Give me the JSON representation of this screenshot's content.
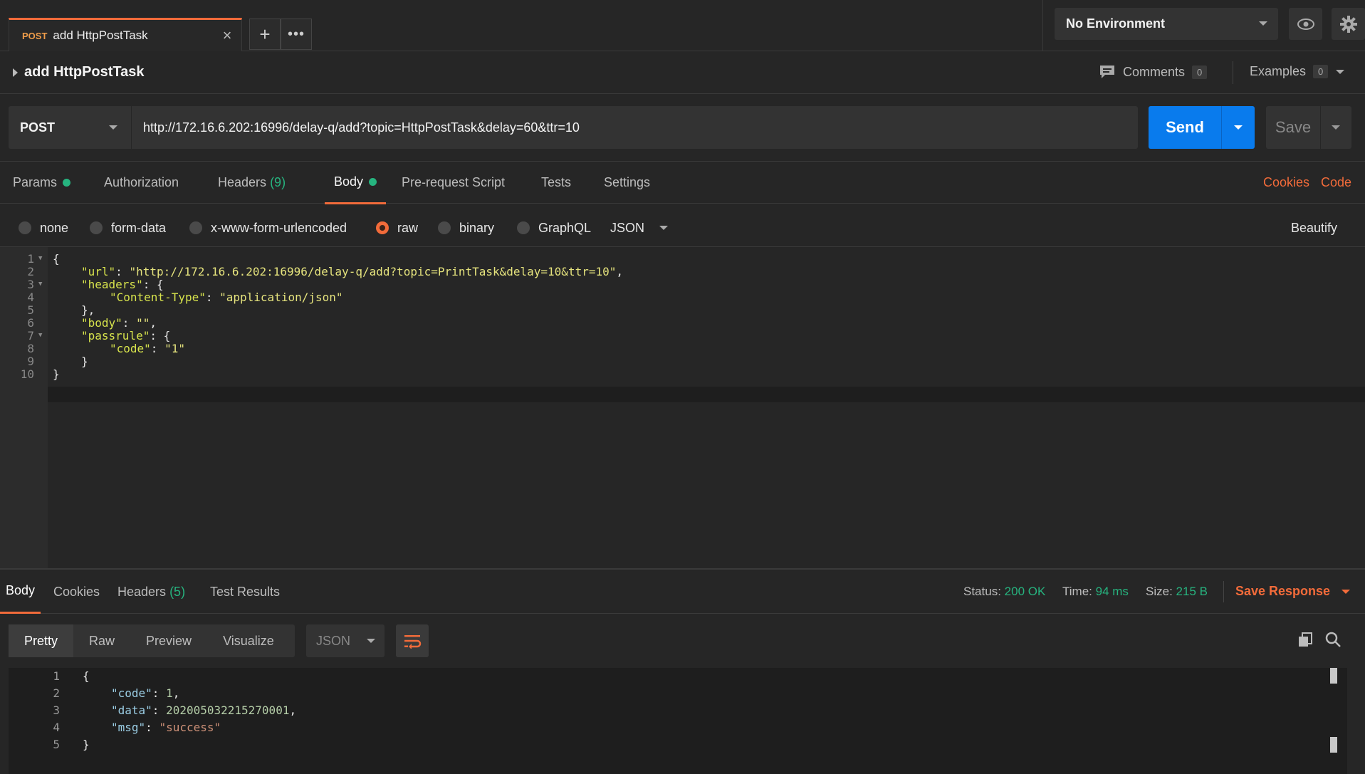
{
  "tab": {
    "method": "POST",
    "name": "add HttpPostTask"
  },
  "environment": {
    "selected": "No Environment"
  },
  "request": {
    "title": "add HttpPostTask",
    "comments_label": "Comments",
    "comments_count": "0",
    "examples_label": "Examples",
    "examples_count": "0",
    "method": "POST",
    "url": "http://172.16.6.202:16996/delay-q/add?topic=HttpPostTask&delay=60&ttr=10",
    "send_label": "Send",
    "save_label": "Save"
  },
  "request_tabs": {
    "params": "Params",
    "authorization": "Authorization",
    "headers": "Headers",
    "headers_count": "(9)",
    "body": "Body",
    "prerequest": "Pre-request Script",
    "tests": "Tests",
    "settings": "Settings",
    "cookies": "Cookies",
    "code": "Code"
  },
  "body_modes": {
    "none": "none",
    "form_data": "form-data",
    "urlencoded": "x-www-form-urlencoded",
    "raw": "raw",
    "binary": "binary",
    "graphql": "GraphQL",
    "format": "JSON",
    "beautify": "Beautify",
    "selected": "raw"
  },
  "request_body_lines": [
    {
      "n": "1",
      "t": "{"
    },
    {
      "n": "2",
      "k": "\"url\"",
      "v": "\"http://172.16.6.202:16996/delay-q/add?topic=PrintTask&delay=10&ttr=10\"",
      "e": ","
    },
    {
      "n": "3",
      "k": "\"headers\"",
      "e": ": {"
    },
    {
      "n": "4",
      "k": "\"Content-Type\"",
      "v": "\"application/json\""
    },
    {
      "n": "5",
      "t": "},"
    },
    {
      "n": "6",
      "k": "\"body\"",
      "v": "\"\"",
      "e": ","
    },
    {
      "n": "7",
      "k": "\"passrule\"",
      "e": ": {"
    },
    {
      "n": "8",
      "k": "\"code\"",
      "v": "\"1\""
    },
    {
      "n": "9",
      "t": "}"
    },
    {
      "n": "10",
      "t": "}"
    }
  ],
  "response_tabs": {
    "body": "Body",
    "cookies": "Cookies",
    "headers": "Headers",
    "headers_count": "(5)",
    "test_results": "Test Results"
  },
  "response_status": {
    "status_label": "Status:",
    "status_value": "200 OK",
    "time_label": "Time:",
    "time_value": "94 ms",
    "size_label": "Size:",
    "size_value": "215 B",
    "save_response": "Save Response"
  },
  "response_view": {
    "pretty": "Pretty",
    "raw": "Raw",
    "preview": "Preview",
    "visualize": "Visualize",
    "format": "JSON"
  },
  "response_body_lines": [
    {
      "n": "1",
      "t": "{"
    },
    {
      "n": "2",
      "k": "\"code\"",
      "num": "1",
      "e": ","
    },
    {
      "n": "3",
      "k": "\"data\"",
      "num": "202005032215270001",
      "e": ","
    },
    {
      "n": "4",
      "k": "\"msg\"",
      "s": "\"success\""
    },
    {
      "n": "5",
      "t": "}"
    }
  ],
  "colors": {
    "accent": "#f26b3a",
    "send": "#097bed",
    "success": "#26b47f"
  }
}
